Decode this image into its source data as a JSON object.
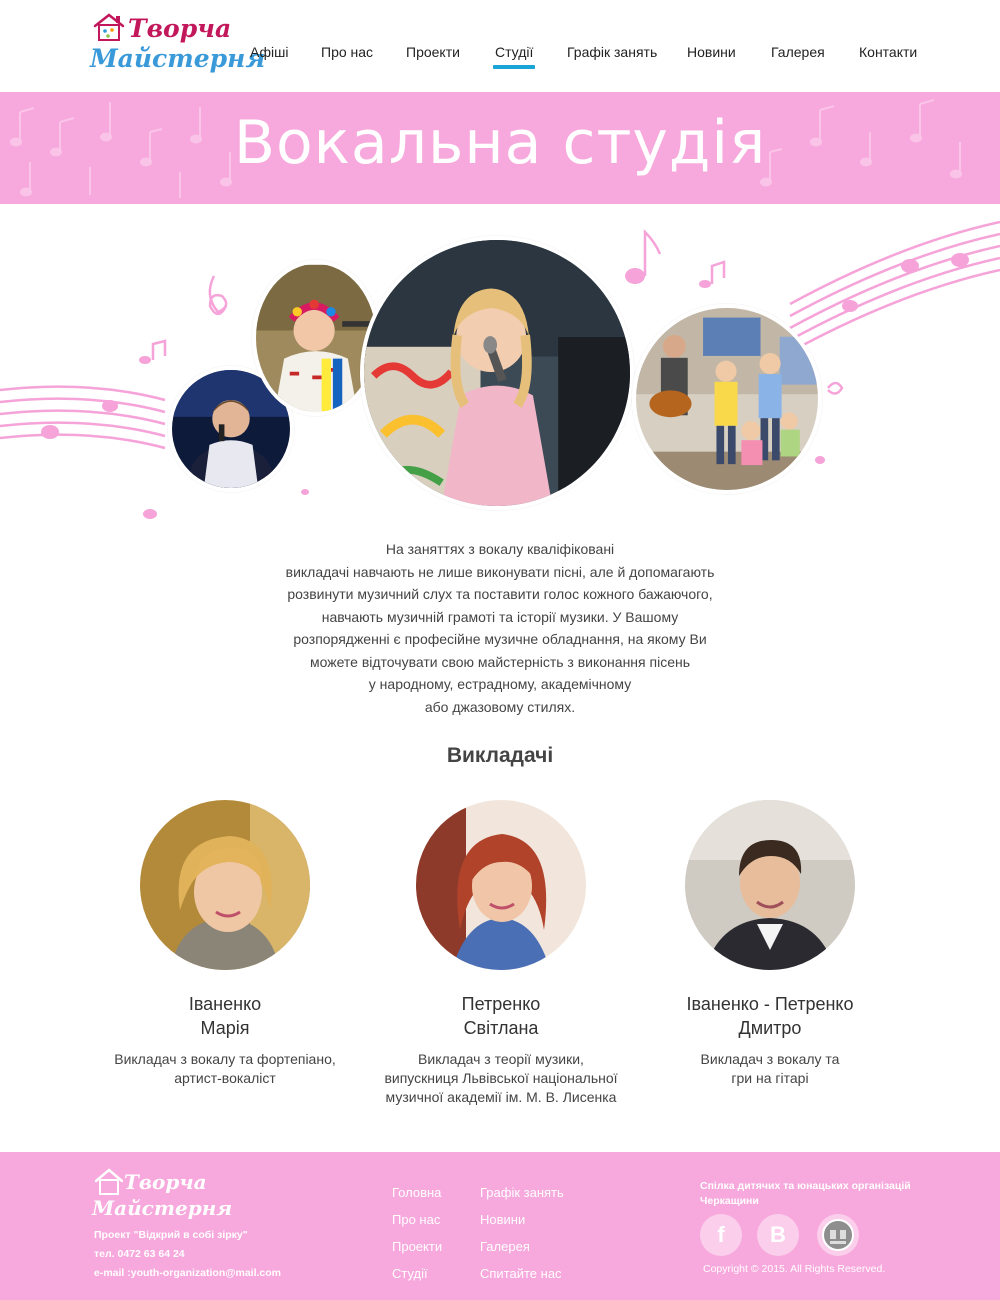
{
  "header": {
    "logo_line1": "Творча",
    "logo_line2": "Майстерня",
    "nav": [
      "Афіші",
      "Про нас",
      "Проекти",
      "Студії",
      "Графік занять",
      "Новини",
      "Галерея",
      "Контакти"
    ],
    "active_nav": "Студії",
    "accent_color": "#18a5d6"
  },
  "banner": {
    "title": "Вокальна студія",
    "background_color": "#f7a8dc"
  },
  "description": [
    "На заняттях з вокалу кваліфіковані",
    "викладачі навчають не лише виконувати пісні, але й допомагають",
    "розвинути музичний слух та поставити голос кожного бажаючого,",
    "навчають музичній грамоті та історії музики.  У Вашому",
    "розпорядженні є професійне музичне обладнання, на якому Ви",
    "можете відточувати свою майстерність з виконання пісень",
    "у народному, естрадному, академічному",
    "або джазовому стилях."
  ],
  "teachers_title": "Викладачі",
  "teachers": [
    {
      "name_line1": "Іваненко",
      "name_line2": "Марія",
      "role_line1": "Викладач з вокалу та фортепіано,",
      "role_line2": "артист-вокаліст",
      "role_line3": ""
    },
    {
      "name_line1": "Петренко",
      "name_line2": "Світлана",
      "role_line1": "Викладач з теорії музики,",
      "role_line2": "випускниця Львівської національної",
      "role_line3": "музичної академії ім. М. В. Лисенка"
    },
    {
      "name_line1": "Іваненко - Петренко",
      "name_line2": "Дмитро",
      "role_line1": "Викладач з вокалу та",
      "role_line2": "гри на гітарі",
      "role_line3": ""
    }
  ],
  "footer": {
    "logo_line1": "Творча",
    "logo_line2": "Майстерня",
    "project": "Проект \"Відкрий в собі зірку\"",
    "phone": "тел. 0472 63 64 24",
    "email": "e-mail :youth-organization@mail.com",
    "links_col1": [
      "Головна",
      "Про нас",
      "Проекти",
      "Студії"
    ],
    "links_col2": [
      "Графік занять",
      "Новини",
      "Галерея",
      "Спитайте нас"
    ],
    "org": "Спілка дитячих та юнацьких організацій Черкащини",
    "social": [
      {
        "icon": "facebook-icon",
        "glyph": "f"
      },
      {
        "icon": "vkontakte-icon",
        "glyph": "B"
      },
      {
        "icon": "organization-emblem-icon",
        "glyph": ""
      }
    ],
    "copyright": "Copyright © 2015.  All Rights Reserved."
  }
}
